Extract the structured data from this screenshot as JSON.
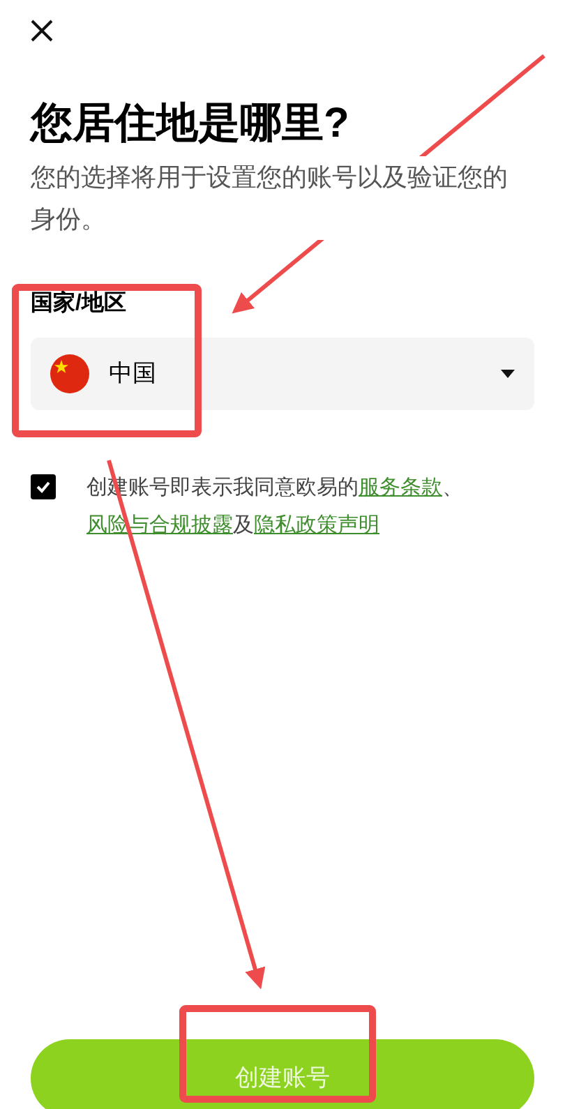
{
  "title": "您居住地是哪里?",
  "description": "您的选择将用于设置您的账号以及验证您的身份。",
  "country_field": {
    "label": "国家/地区",
    "value": "中国"
  },
  "consent": {
    "checked": true,
    "parts": [
      {
        "kind": "text",
        "text": "创建账号即表示我同意欧易的"
      },
      {
        "kind": "link",
        "text": "服务条款"
      },
      {
        "kind": "text",
        "text": "、"
      },
      {
        "kind": "link",
        "text": "风险与合规披露"
      },
      {
        "kind": "text",
        "text": "及"
      },
      {
        "kind": "link",
        "text": "隐私政策声明"
      }
    ]
  },
  "primary_button": "创建账号"
}
